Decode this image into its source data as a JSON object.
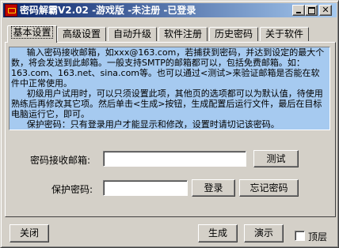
{
  "window": {
    "title": "密码解霸V2.02 -游戏版 -未注册 -已登录",
    "title_bar_color": "#0a246a"
  },
  "tabs": [
    {
      "label": "基本设置",
      "active": true
    },
    {
      "label": "高级设置",
      "active": false
    },
    {
      "label": "自动升级",
      "active": false
    },
    {
      "label": "软件注册",
      "active": false
    },
    {
      "label": "历史密码",
      "active": false
    },
    {
      "label": "关于软件",
      "active": false
    }
  ],
  "info": {
    "background": "#a6caf0",
    "paragraphs": [
      "输入密码接收邮箱，如xxx@163.com，若捕获到密码，并达到设定的最大个数，将会发送到此邮箱。一般支持SMTP的邮箱都可以，包括免费邮箱。如：163.com、163.net、sina.com等。也可以通过<测试>来验证邮箱是否能在软件中正常使用。",
      "初级用户试用时，可以只须设置此项，其他页的选项都可以为默认值，待使用熟练后再修改其它项。然后单击<生成>按钮，生成配置后运行文件，最后在目标电脑运行它，即可。",
      "保护密码：只有登录用户才能显示和修改，设置时请切记该密码。"
    ]
  },
  "form": {
    "email_label": "密码接收邮箱:",
    "email_value": "",
    "test_button": "测试",
    "password_label": "保护密码:",
    "password_value": "",
    "login_button": "登录",
    "forgot_button": "忘记密码"
  },
  "footer": {
    "close_button": "关闭",
    "generate_button": "生成",
    "demo_button": "演示",
    "topmost_label": "顶层",
    "topmost_checked": false
  }
}
